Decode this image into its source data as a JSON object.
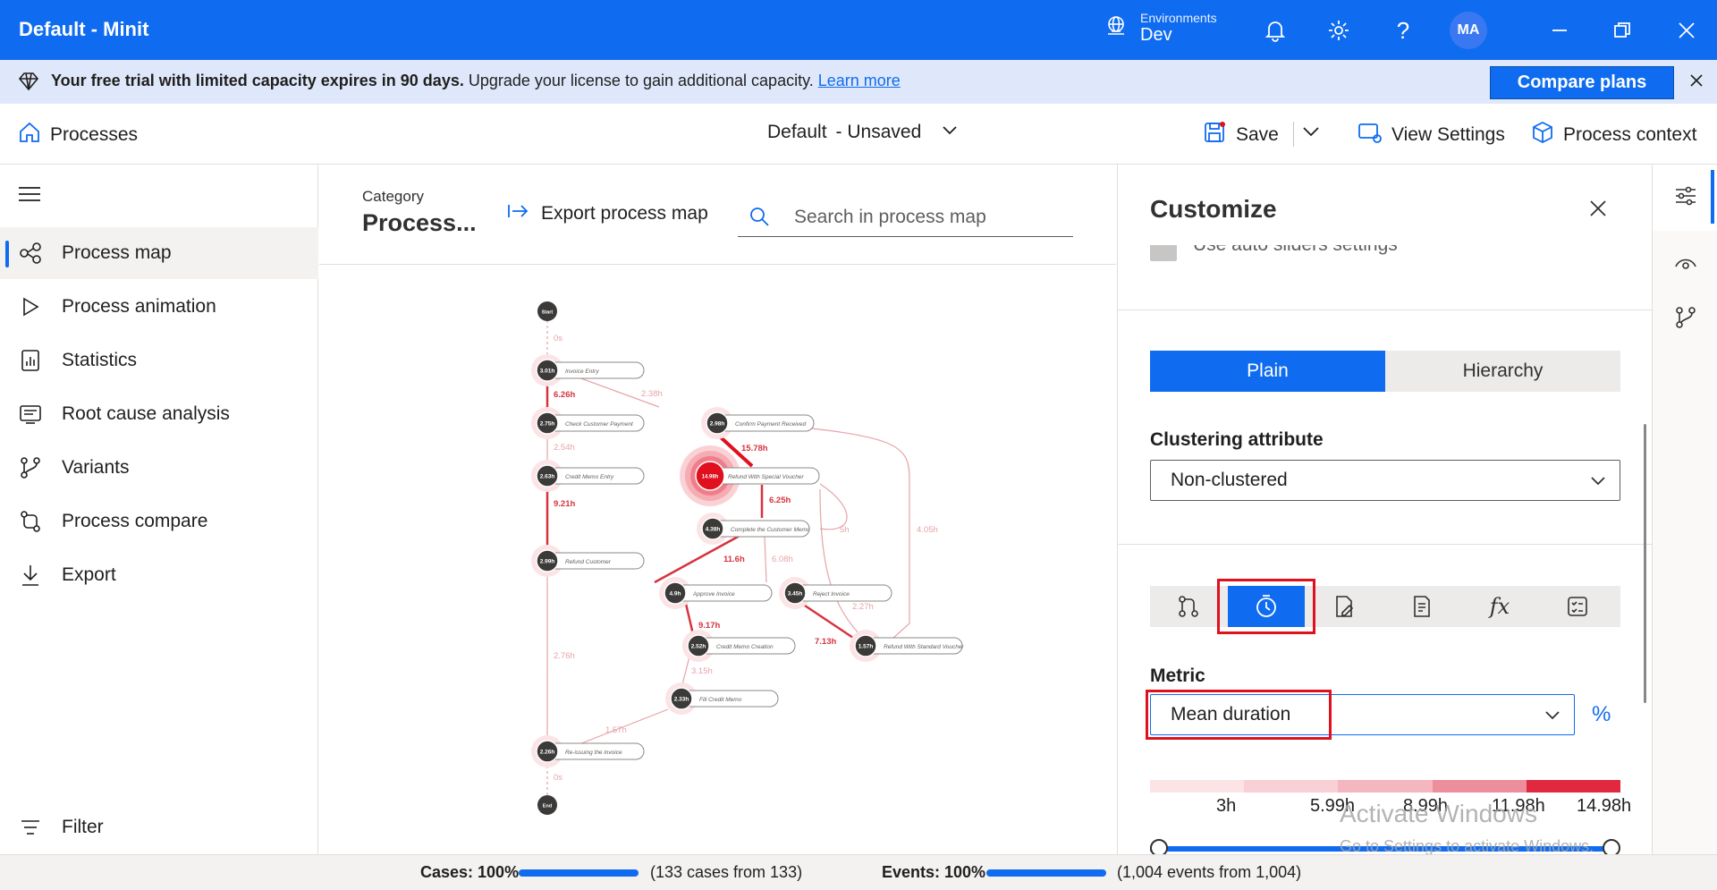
{
  "window": {
    "title": "Default - Minit",
    "env_label": "Environments",
    "env_value": "Dev",
    "avatar": "MA"
  },
  "banner": {
    "bold": "Your free trial with limited capacity expires in 90 days.",
    "text": " Upgrade your license to gain additional capacity.",
    "link": "Learn more",
    "button": "Compare plans"
  },
  "cmdbar": {
    "processes": "Processes",
    "view_name": "Default",
    "view_status": "- Unsaved",
    "save": "Save",
    "view_settings": "View Settings",
    "process_context": "Process context"
  },
  "sidebar": {
    "items": [
      {
        "label": "Process map",
        "icon": "process-map-icon"
      },
      {
        "label": "Process animation",
        "icon": "play-icon"
      },
      {
        "label": "Statistics",
        "icon": "statistics-icon"
      },
      {
        "label": "Root cause analysis",
        "icon": "root-cause-icon"
      },
      {
        "label": "Variants",
        "icon": "variants-icon"
      },
      {
        "label": "Process compare",
        "icon": "compare-icon"
      },
      {
        "label": "Export",
        "icon": "download-icon"
      }
    ],
    "filter": "Filter"
  },
  "main": {
    "category_label": "Category",
    "category_value": "Process...",
    "export": "Export process map",
    "search_placeholder": "Search in process map"
  },
  "map": {
    "nodes": [
      {
        "id": "start",
        "label": "Start"
      },
      {
        "id": "invoice_entry",
        "badge": "3.01h",
        "label": "Invoice Entry"
      },
      {
        "id": "check_payment",
        "badge": "2.75h",
        "label": "Check Customer Payment"
      },
      {
        "id": "confirm_payment",
        "badge": "2.98h",
        "label": "Confirm Payment Received"
      },
      {
        "id": "credit_memo_entry",
        "badge": "2.63h",
        "label": "Credit Memo Entry"
      },
      {
        "id": "refund_special",
        "badge": "14.98h",
        "label": "Refund With Special Voucher"
      },
      {
        "id": "complete_memo",
        "badge": "4.38h",
        "label": "Complete the Customer Memo"
      },
      {
        "id": "refund_customer",
        "badge": "2.99h",
        "label": "Refund Customer"
      },
      {
        "id": "approve_invoice",
        "badge": "4.9h",
        "label": "Approve Invoice"
      },
      {
        "id": "reject_invoice",
        "badge": "3.45h",
        "label": "Reject Invoice"
      },
      {
        "id": "credit_memo_creation",
        "badge": "2.52h",
        "label": "Credit Memo Creation"
      },
      {
        "id": "refund_standard",
        "badge": "1.57h",
        "label": "Refund With Standard Voucher"
      },
      {
        "id": "fill_credit_memo",
        "badge": "2.33h",
        "label": "Fill Credit Memo"
      },
      {
        "id": "reissuing",
        "badge": "2.26h",
        "label": "Re-issuing the invoice"
      },
      {
        "id": "end",
        "label": "End"
      }
    ],
    "edges": [
      "0s",
      "6.26h",
      "2.38h",
      "2.54h",
      "15.78h",
      "9.21h",
      "6.25h",
      "5h",
      "4.05h",
      "11.6h",
      "6.08h",
      "2.27h",
      "9.17h",
      "7.13h",
      "2.76h",
      "3.15h",
      "1.57h",
      "0s"
    ]
  },
  "panel": {
    "title": "Customize",
    "auto_sliders": "Use auto sliders settings",
    "tab_plain": "Plain",
    "tab_hierarchy": "Hierarchy",
    "clustering_label": "Clustering attribute",
    "clustering_value": "Non-clustered",
    "metric_tabs": [
      "frequency-icon",
      "duration-clock-icon",
      "edit-icon",
      "document-icon",
      "formula-icon",
      "checklist-icon"
    ],
    "metric_label": "Metric",
    "metric_value": "Mean duration",
    "percent": "%",
    "legend": [
      "3h",
      "5.99h",
      "8.99h",
      "11.98h",
      "14.98h"
    ],
    "legend_colors": [
      "#fbe3e6",
      "#f8d0d6",
      "#f4b6bf",
      "#ec8e9b",
      "#e0293f"
    ],
    "watermark_title": "Activate Windows",
    "watermark_text": "Go to Settings to activate Windows."
  },
  "footer": {
    "cases_label": "Cases: 100%",
    "cases_detail": "(133 cases from 133)",
    "events_label": "Events: 100%",
    "events_detail": "(1,004 events from 1,004)",
    "cases_progress": 1.0,
    "events_progress": 1.0
  },
  "colors": {
    "accent": "#0f6cf0",
    "highlight": "#e0101e",
    "edge_strong": "#d6333f",
    "edge_light": "#e6a3a8"
  }
}
